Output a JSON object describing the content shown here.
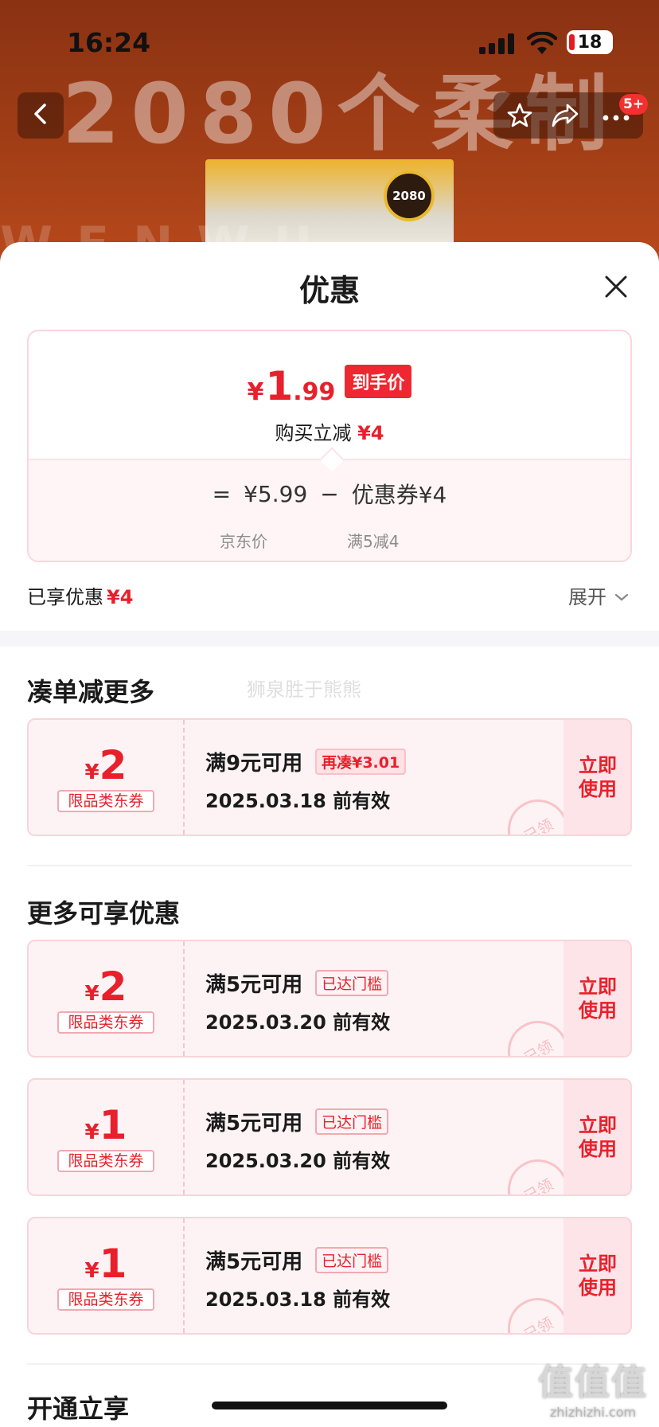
{
  "status_bar": {
    "time": "16:24",
    "battery": "18"
  },
  "background": {
    "headline": "2080个柔制",
    "badge": "2080",
    "strip": "WENWU"
  },
  "nav": {
    "count_badge": "5+"
  },
  "sheet": {
    "title": "优惠",
    "final_price": {
      "currency": "¥",
      "integer": "1",
      "decimal": ".99",
      "tag": "到手价"
    },
    "reduce_label": "购买立减",
    "reduce_amount": "¥4",
    "breakdown": {
      "equals": "=",
      "base_price": "¥5.99",
      "minus": "−",
      "coupon_label": "优惠券¥4",
      "base_caption": "京东价",
      "coupon_caption": "满5减4"
    },
    "enjoyed_label": "已享优惠",
    "enjoyed_amount": "¥4",
    "expand_label": "展开"
  },
  "section_more": {
    "title": "凑单减更多",
    "watermark": "狮泉胜于熊熊"
  },
  "section_available": {
    "title": "更多可享优惠"
  },
  "section_open": {
    "title": "开通立享"
  },
  "coupons": [
    {
      "currency": "¥",
      "value": "2",
      "type": "限品类东券",
      "condition": "满9元可用",
      "tag": "再凑¥3.01",
      "expiry": "2025.03.18 前有效",
      "stamp": "已领",
      "button": "立即使用"
    },
    {
      "currency": "¥",
      "value": "2",
      "type": "限品类东券",
      "condition": "满5元可用",
      "tag": "已达门槛",
      "expiry": "2025.03.20 前有效",
      "stamp": "已领",
      "button": "立即使用"
    },
    {
      "currency": "¥",
      "value": "1",
      "type": "限品类东券",
      "condition": "满5元可用",
      "tag": "已达门槛",
      "expiry": "2025.03.20 前有效",
      "stamp": "已领",
      "button": "立即使用"
    },
    {
      "currency": "¥",
      "value": "1",
      "type": "限品类东券",
      "condition": "满5元可用",
      "tag": "已达门槛",
      "expiry": "2025.03.18 前有效",
      "stamp": "已领",
      "button": "立即使用"
    }
  ],
  "corner_watermark": {
    "logo": "值值值",
    "domain": "zhizhizhi.com"
  },
  "colors": {
    "accent": "#e8202b",
    "coupon_bg": "#fdf3f5",
    "header_bg": "#a23e16"
  },
  "icons": [
    "back-arrow-icon",
    "star-icon",
    "share-icon",
    "more-icon",
    "close-icon",
    "chevron-down-icon",
    "signal-icon",
    "wifi-icon",
    "battery-icon"
  ]
}
